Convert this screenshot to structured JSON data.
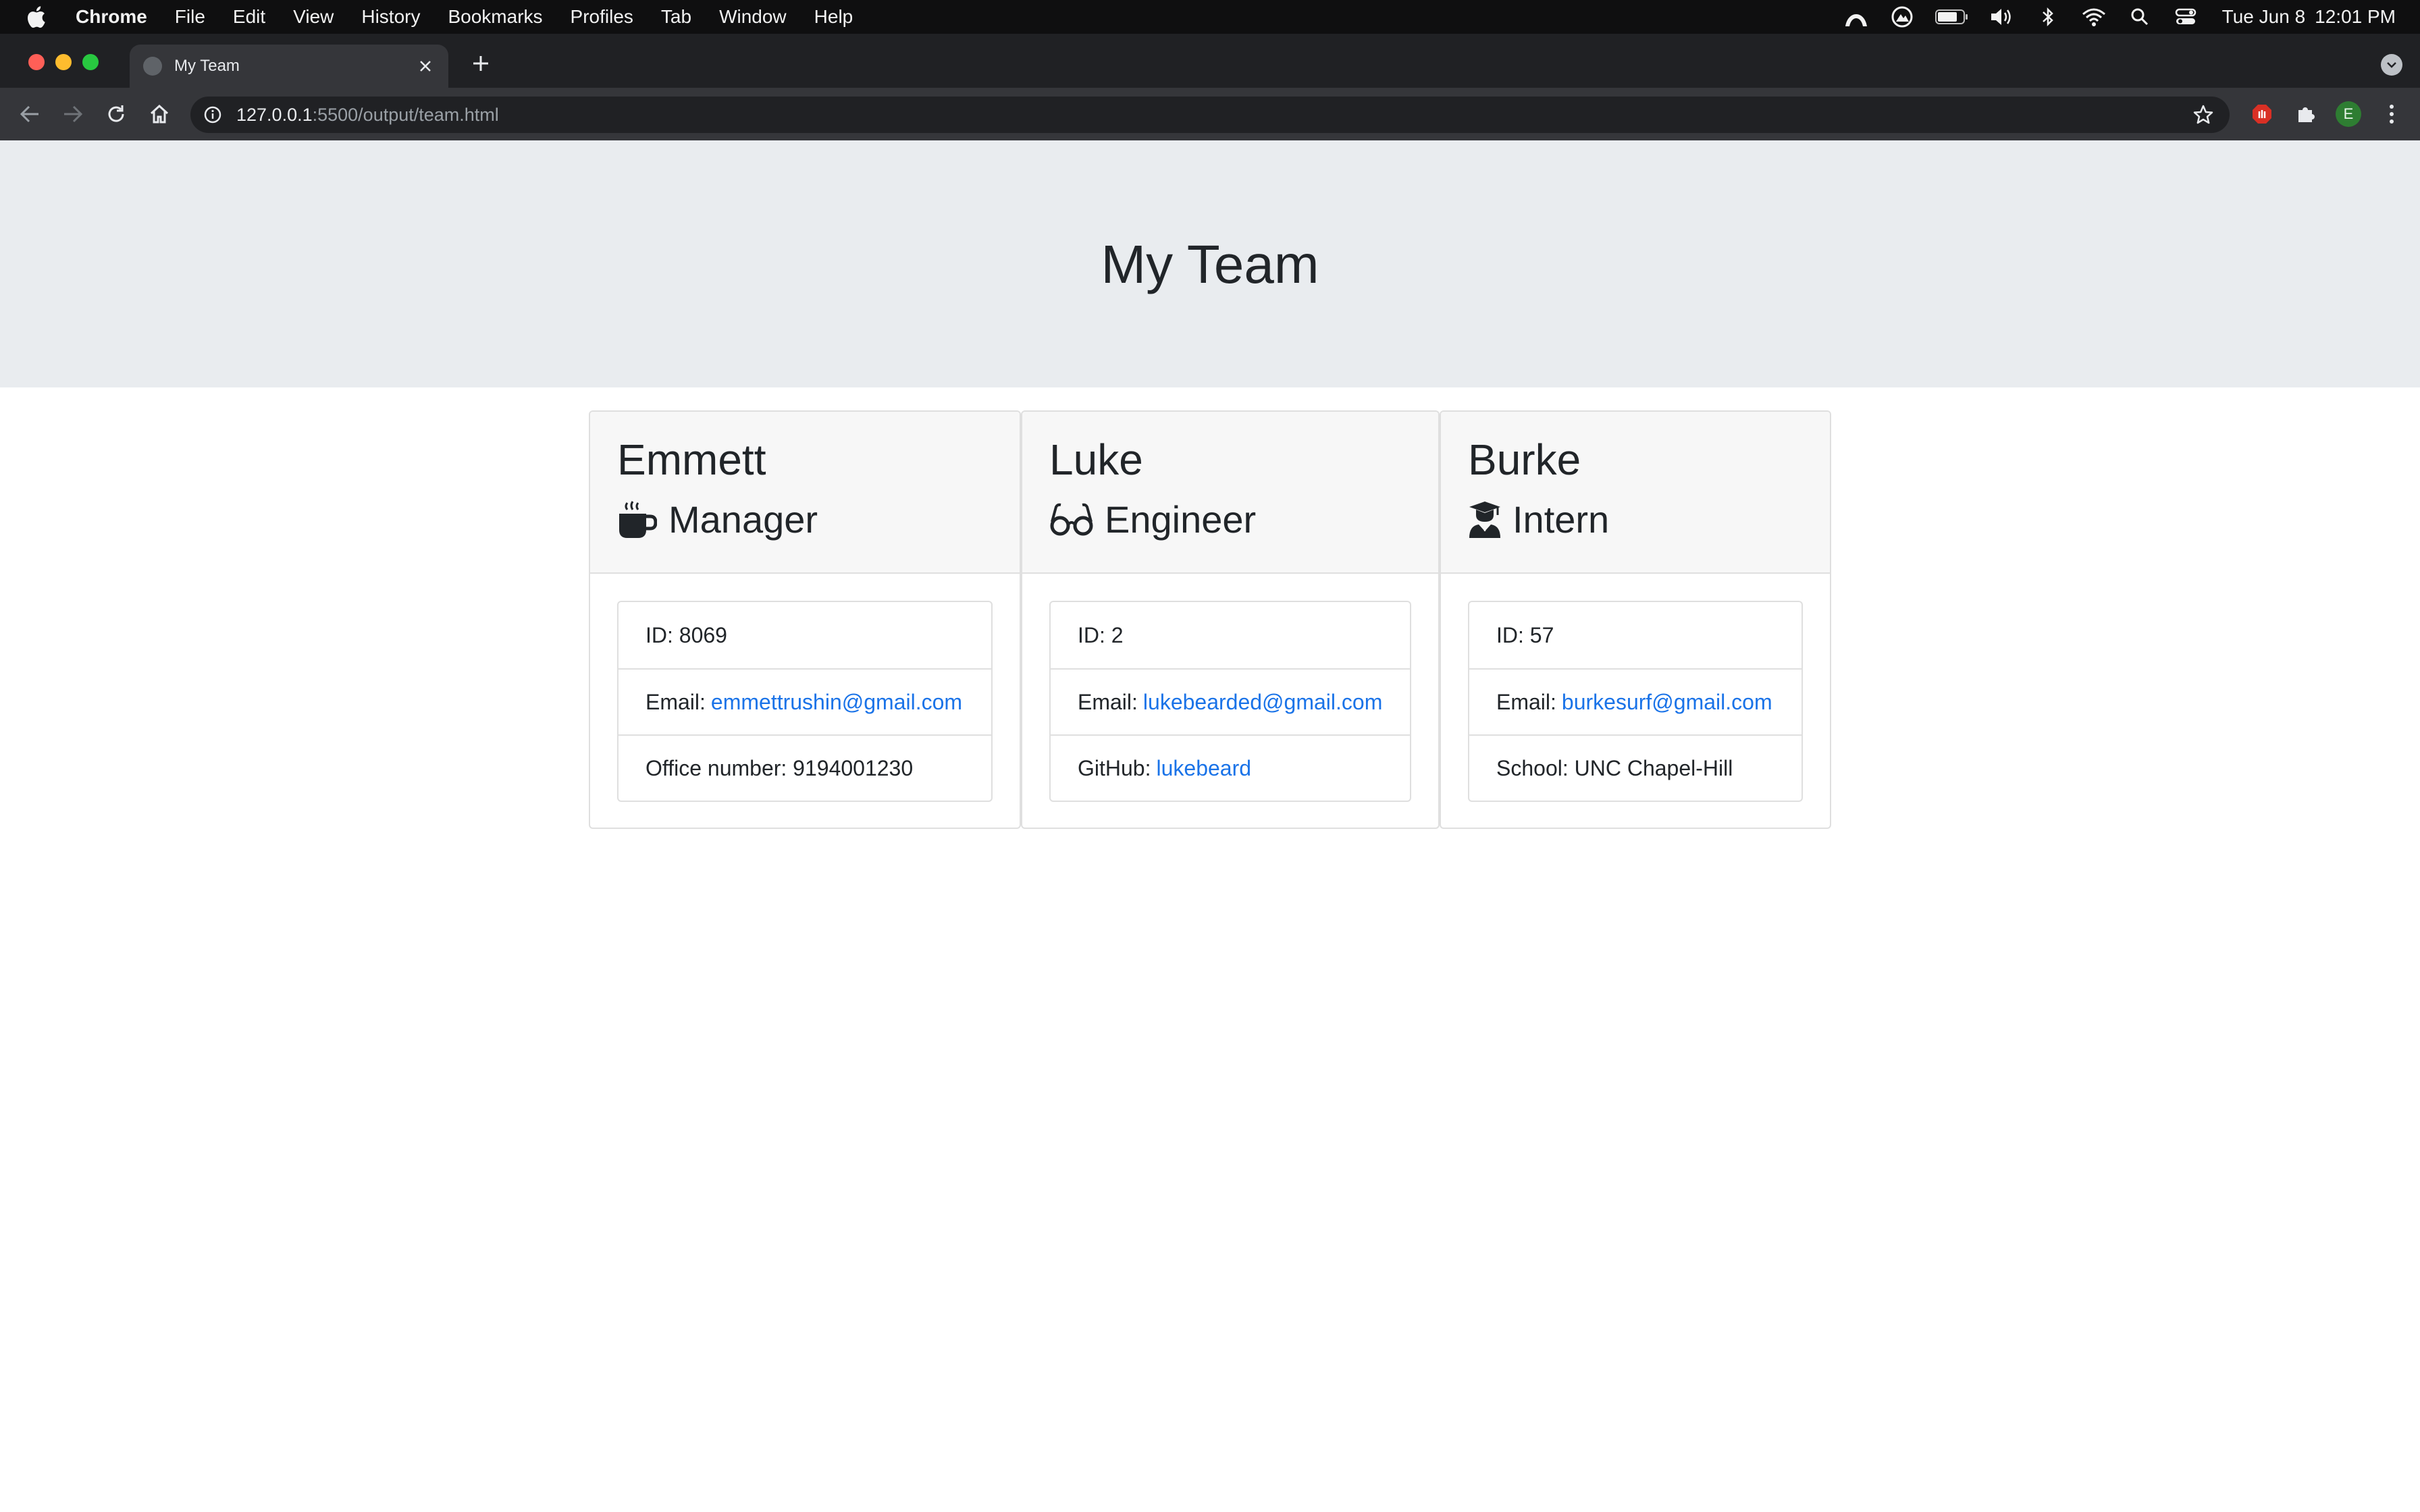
{
  "menubar": {
    "app_name": "Chrome",
    "menus": [
      "File",
      "Edit",
      "View",
      "History",
      "Bookmarks",
      "Profiles",
      "Tab",
      "Window",
      "Help"
    ],
    "clock_date": "Tue Jun 8",
    "clock_time": "12:01 PM"
  },
  "browser": {
    "tab_title": "My Team",
    "url_host": "127.0.0.1",
    "url_path": ":5500/output/team.html",
    "profile_initial": "E"
  },
  "page": {
    "title": "My Team",
    "employees": [
      {
        "name": "Emmett",
        "role": "Manager",
        "role_icon": "mug-icon",
        "id_label": "ID:",
        "id": "8069",
        "email_label": "Email:",
        "email": "emmettrushin@gmail.com",
        "extra_label": "Office number:",
        "extra_value": "9194001230"
      },
      {
        "name": "Luke",
        "role": "Engineer",
        "role_icon": "glasses-icon",
        "id_label": "ID:",
        "id": "2",
        "email_label": "Email:",
        "email": "lukebearded@gmail.com",
        "extra_label": "GitHub:",
        "extra_value": "lukebeard"
      },
      {
        "name": "Burke",
        "role": "Intern",
        "role_icon": "graduate-icon",
        "id_label": "ID:",
        "id": "57",
        "email_label": "Email:",
        "email": "burkesurf@gmail.com",
        "extra_label": "School:",
        "extra_value": "UNC Chapel-Hill"
      }
    ]
  },
  "colors": {
    "link": "#1a73e8",
    "jumbotron_bg": "#e9ecef",
    "card_header_bg": "#f7f7f7"
  }
}
